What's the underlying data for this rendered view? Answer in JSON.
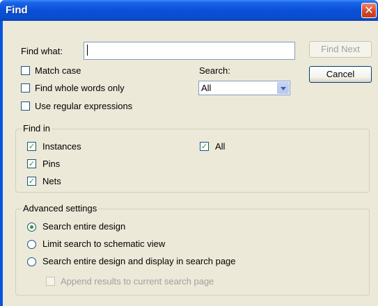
{
  "window": {
    "title": "Find",
    "close_glyph": "✕"
  },
  "find_what": {
    "label": "Find what:",
    "value": "",
    "placeholder": ""
  },
  "buttons": {
    "find_next": "Find Next",
    "cancel": "Cancel"
  },
  "options": {
    "match_case": {
      "label": "Match case",
      "checked": false
    },
    "whole_words": {
      "label": "Find whole words only",
      "checked": false
    },
    "regex": {
      "label": "Use regular expressions",
      "checked": false
    }
  },
  "search": {
    "label": "Search:",
    "selected": "All"
  },
  "find_in": {
    "legend": "Find in",
    "instances": {
      "label": "Instances",
      "checked": true
    },
    "pins": {
      "label": "Pins",
      "checked": true
    },
    "nets": {
      "label": "Nets",
      "checked": true
    },
    "all": {
      "label": "All",
      "checked": true
    }
  },
  "advanced": {
    "legend": "Advanced settings",
    "entire_design": {
      "label": "Search entire design",
      "selected": true
    },
    "schematic_view": {
      "label": "Limit search to schematic view",
      "selected": false
    },
    "search_page": {
      "label": "Search entire design and display in search page",
      "selected": false
    },
    "append": {
      "label": "Append results to current search page",
      "checked": false,
      "enabled": false
    }
  },
  "glyphs": {
    "check": "✓"
  }
}
